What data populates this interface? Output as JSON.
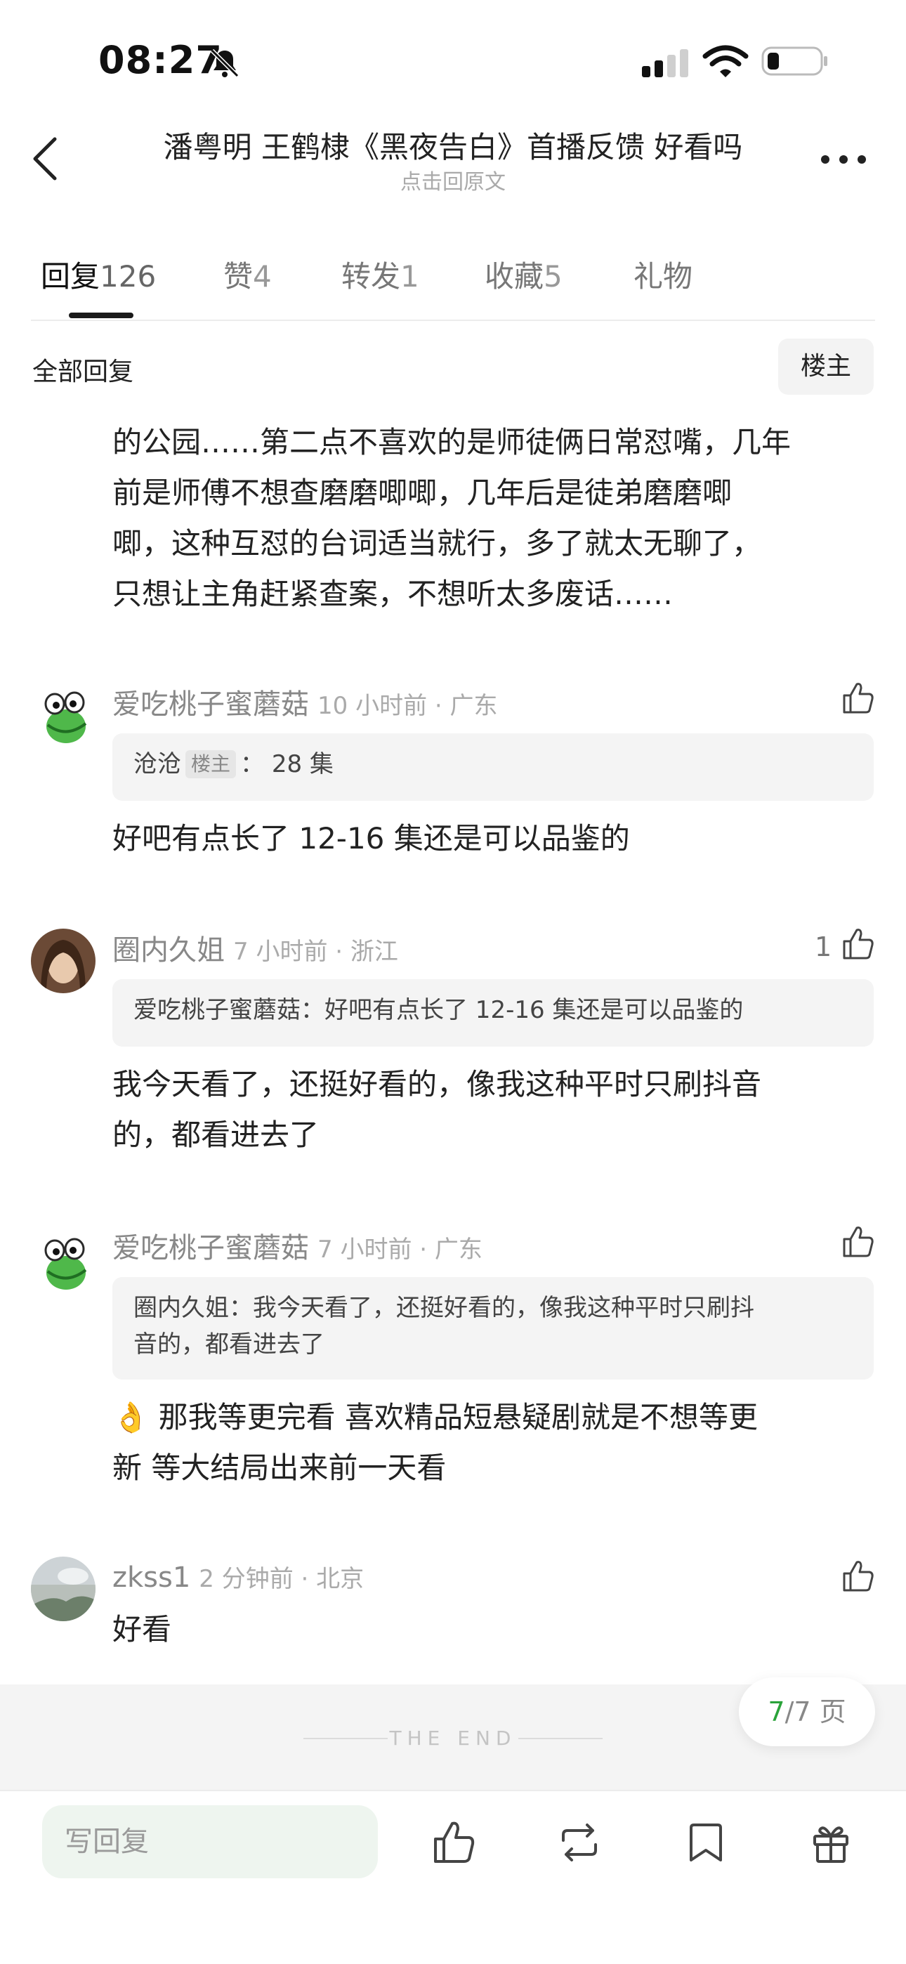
{
  "status_bar": {
    "time": "08:27"
  },
  "header": {
    "title": "潘粤明 王鹤棣《黑夜告白》首播反馈 好看吗",
    "subtitle": "点击回原文"
  },
  "tabs": [
    {
      "label": "回复",
      "count": "126"
    },
    {
      "label": "赞",
      "count": "4"
    },
    {
      "label": "转发",
      "count": "1"
    },
    {
      "label": "收藏",
      "count": "5"
    },
    {
      "label": "礼物",
      "count": ""
    }
  ],
  "filter": {
    "all_replies": "全部回复",
    "op_only": "楼主"
  },
  "truncated_comment": {
    "lines": [
      "的公园……第二点不喜欢的是师徒俩日常怼嘴，几年",
      "前是师傅不想查磨磨唧唧，几年后是徒弟磨磨唧",
      "唧，这种互怼的台词适当就行，多了就太无聊了，",
      "只想让主角赶紧查案，不想听太多废话……"
    ]
  },
  "comments": [
    {
      "user": "爱吃桃子蜜蘑菇",
      "meta": "10 小时前 · 广东",
      "likes": "",
      "quote_user": "沧沧",
      "quote_tag": "楼主",
      "quote_sep": "：",
      "quote_text": "28 集",
      "text_lines": [
        "好吧有点长了 12-16 集还是可以品鉴的"
      ]
    },
    {
      "user": "圈内久姐",
      "meta": "7 小时前 · 浙江",
      "likes": "1",
      "quote_user": "爱吃桃子蜜蘑菇：",
      "quote_text": "好吧有点长了 12-16 集还是可以品鉴的",
      "text_lines": [
        "我今天看了，还挺好看的，像我这种平时只刷抖音",
        "的，都看进去了"
      ]
    },
    {
      "user": "爱吃桃子蜜蘑菇",
      "meta": "7 小时前 · 广东",
      "likes": "",
      "quote_lines": [
        "圈内久姐：我今天看了，还挺好看的，像我这种平时只刷抖",
        "音的，都看进去了"
      ],
      "text_lines": [
        "👌 那我等更完看 喜欢精品短悬疑剧就是不想等更",
        "新 等大结局出来前一天看"
      ]
    },
    {
      "user": "zkss1",
      "meta": "2 分钟前 · 北京",
      "likes": "",
      "text_lines": [
        "好看"
      ]
    }
  ],
  "end_marker": "THE END",
  "pagination": {
    "current": "7",
    "total": "/7 页"
  },
  "bottom_bar": {
    "reply_placeholder": "写回复"
  },
  "colors": {
    "accent": "#2aa33a",
    "reply_bg": "#eef5ef"
  }
}
